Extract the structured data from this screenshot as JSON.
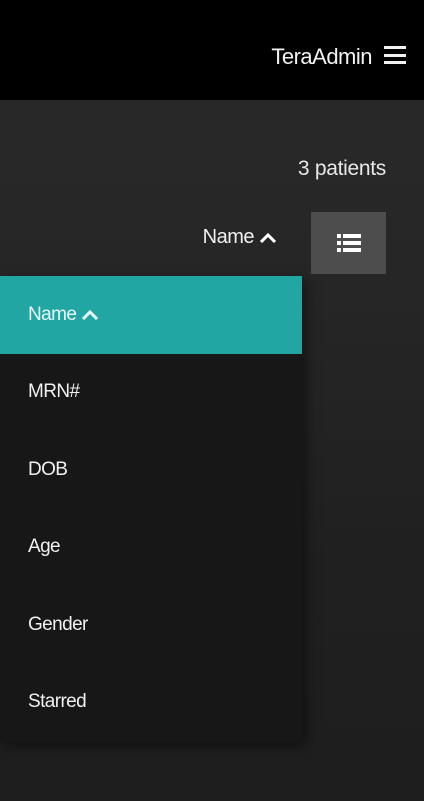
{
  "header": {
    "user_name": "TeraAdmin",
    "menu_icon": "hamburger-menu-icon"
  },
  "patients": {
    "count_label": "3 patients"
  },
  "sort": {
    "current_label": "Name",
    "direction_icon": "chevron-up-icon",
    "view_toggle_icon": "list-view-icon",
    "options": [
      {
        "label": "Name",
        "active": true
      },
      {
        "label": "MRN#",
        "active": false
      },
      {
        "label": "DOB",
        "active": false
      },
      {
        "label": "Age",
        "active": false
      },
      {
        "label": "Gender",
        "active": false
      },
      {
        "label": "Starred",
        "active": false
      }
    ]
  },
  "colors": {
    "accent": "#22a6a4",
    "header_bg": "#000000",
    "toggle_bg": "#4d4d4d"
  }
}
